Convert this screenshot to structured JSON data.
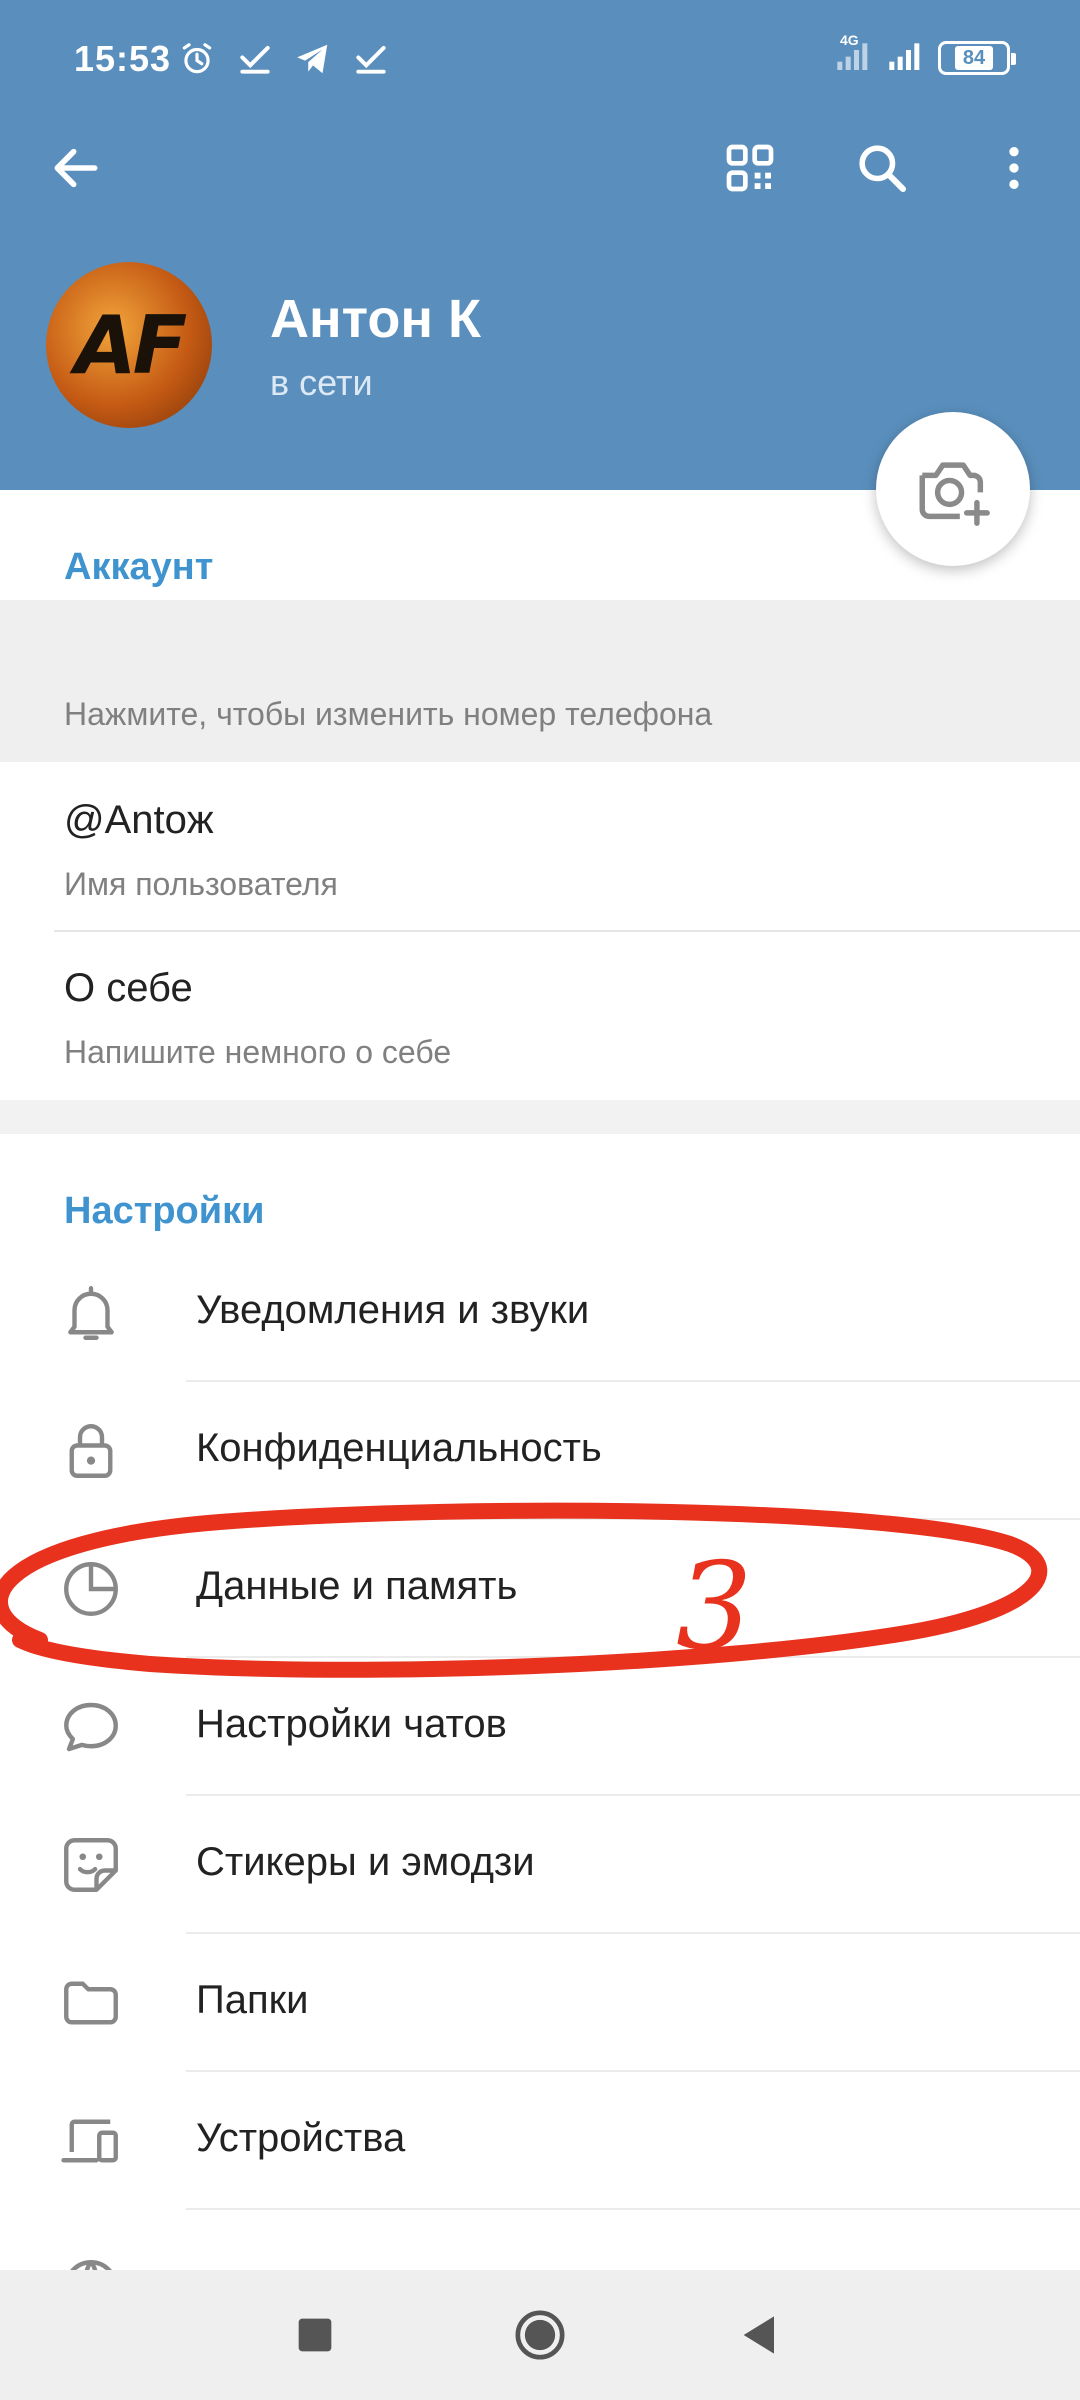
{
  "status_bar": {
    "time": "15:53",
    "network": "4G",
    "battery": "84"
  },
  "icons": {
    "back": "arrow-left-icon",
    "qr": "qr-code-icon",
    "search": "search-icon",
    "more": "more-vertical-icon",
    "camera": "camera-add-icon"
  },
  "profile": {
    "avatar_text": "AF",
    "name": "Антон К",
    "status": "в сети"
  },
  "account": {
    "title": "Аккаунт",
    "phone_value": "",
    "phone_hint": "Нажмите, чтобы изменить номер телефона",
    "username_value": "@Antoж",
    "username_hint": "Имя пользователя",
    "bio_value": "О себе",
    "bio_hint": "Напишите немного о себе"
  },
  "settings": {
    "title": "Настройки",
    "items": [
      {
        "label": "Уведомления и звуки",
        "icon": "bell-icon"
      },
      {
        "label": "Конфиденциальность",
        "icon": "lock-icon"
      },
      {
        "label": "Данные и память",
        "icon": "pie-chart-icon"
      },
      {
        "label": "Настройки чатов",
        "icon": "chat-bubble-icon"
      },
      {
        "label": "Стикеры и эмодзи",
        "icon": "sticker-icon"
      },
      {
        "label": "Папки",
        "icon": "folder-icon"
      },
      {
        "label": "Устройства",
        "icon": "devices-icon"
      }
    ]
  },
  "annotation": {
    "mark": "3",
    "color": "#e8321e"
  },
  "colors": {
    "header": "#5a8fbd",
    "accent": "#3f93cf"
  }
}
